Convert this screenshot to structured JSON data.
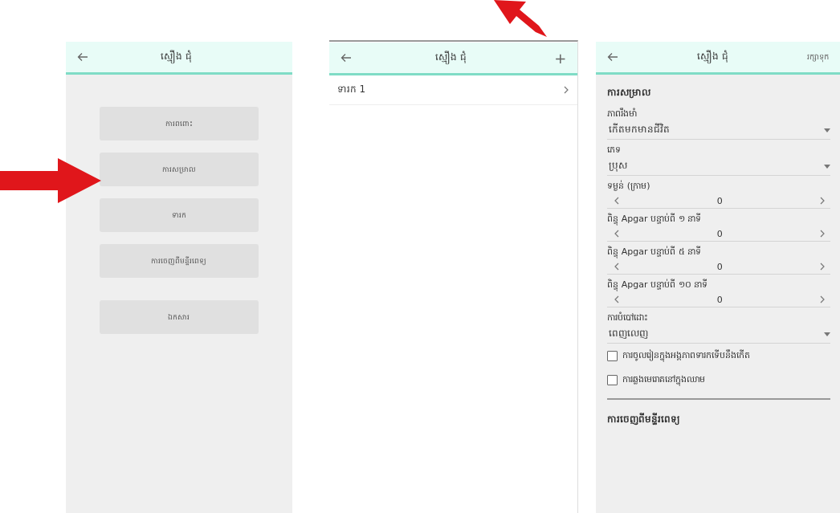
{
  "screens": [
    {
      "kind": "menu",
      "title": "ស្មឿង ជុំ",
      "button_groups": [
        [
          "ការពពោះ",
          "ការសម្រាល",
          "ទារក",
          "ការចេញពីមន្ទីរពេទ្យ"
        ],
        [
          "ឯកសារ"
        ]
      ]
    },
    {
      "kind": "list",
      "title": "ស្មឿង ជុំ",
      "action": "+",
      "rows": [
        {
          "label": "ទារក 1"
        }
      ]
    },
    {
      "kind": "form",
      "title": "ស្មឿង ជុំ",
      "action": "រក្សាទុក",
      "section": "ការសម្រាល",
      "fields": [
        {
          "kind": "select",
          "label": "ភាពរឹងមាំ",
          "value": "កើតមកមានជីវិត"
        },
        {
          "kind": "select",
          "label": "ភេទ",
          "value": "ប្រុស"
        },
        {
          "kind": "stepper",
          "label": "ទម្ងន់ (ក្រាម)",
          "value": "0"
        },
        {
          "kind": "stepper",
          "label": "ពិន្ទុ Apgar បន្ទាប់ពី ១ នាទី",
          "value": "0"
        },
        {
          "kind": "stepper",
          "label": "ពិន្ទុ Apgar បន្ទាប់ពី ៥ នាទី",
          "value": "0"
        },
        {
          "kind": "stepper",
          "label": "ពិន្ទុ Apgar បន្ទាប់ពី ១០ នាទី",
          "value": "0"
        },
        {
          "kind": "select",
          "label": "ការបំបៅដោះ",
          "value": "ពេញលេញ"
        },
        {
          "kind": "checkbox",
          "label": "ការចូលរៀនក្នុងអង្គភាពទារកទើបនឹងកើត",
          "checked": false
        },
        {
          "kind": "checkbox",
          "label": "ការឆ្លងមេរោគនៅក្នុងឈាម",
          "checked": false
        }
      ],
      "next_section": "ការចេញពីមន្ទីរពេទ្យ"
    }
  ]
}
